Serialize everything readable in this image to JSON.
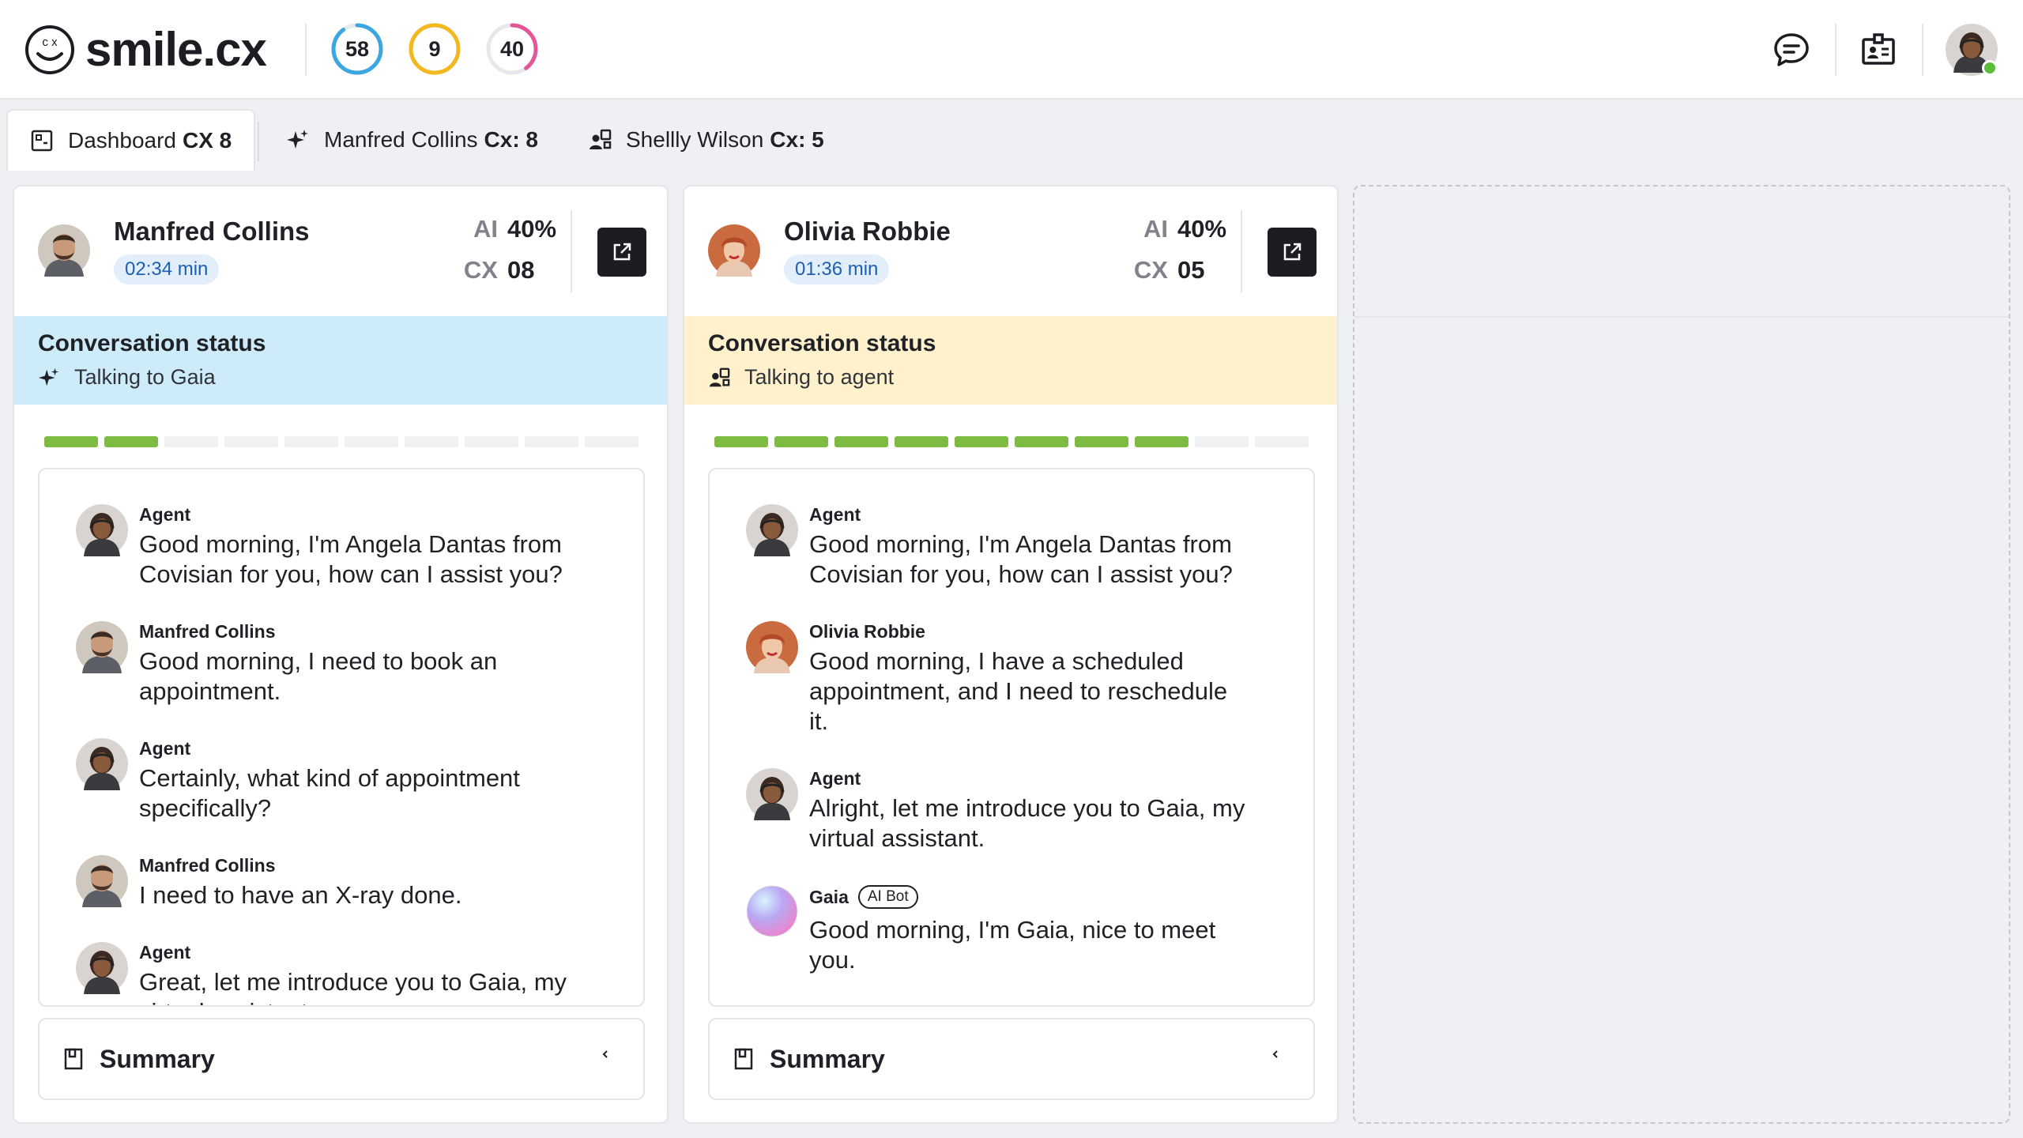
{
  "app": {
    "logo_text": "smile.cx",
    "logo_mark": "c x"
  },
  "header": {
    "rings": [
      {
        "value": "58",
        "color": "#3aa7e0",
        "fraction": 0.9
      },
      {
        "value": "9",
        "color": "#f2b81d",
        "fraction": 1.0
      },
      {
        "value": "40",
        "color": "#e4569a",
        "fraction": 0.4
      }
    ],
    "icons": [
      "chat-bubble-icon",
      "id-badge-icon"
    ],
    "status_color": "#5cbc3c"
  },
  "tabs": [
    {
      "label": "Dashboard",
      "bold": "CX 8",
      "icon": "dashboard-icon",
      "active": true
    },
    {
      "label": "Manfred Collins",
      "bold": "Cx: 8",
      "icon": "sparkle-icon",
      "active": false
    },
    {
      "label": "Shellly Wilson",
      "bold": "Cx: 5",
      "icon": "agent-icon",
      "active": false
    }
  ],
  "panels": [
    {
      "name": "Manfred Collins",
      "time": "02:34 min",
      "ai_label": "AI",
      "ai_value": "40%",
      "cx_label": "CX",
      "cx_value": "08",
      "status_title": "Conversation status",
      "status_text": "Talking to Gaia",
      "progress": 2,
      "progress_total": 10,
      "messages": [
        {
          "author": "Agent",
          "text": "Good morning, I'm Angela Dantas from Covisian for you, how can I assist you?"
        },
        {
          "author": "Manfred Collins",
          "text": "Good morning, I need to book an appointment."
        },
        {
          "author": "Agent",
          "text": "Certainly, what kind of appointment specifically?"
        },
        {
          "author": "Manfred Collins",
          "text": "I need to have an X-ray done."
        },
        {
          "author": "Agent",
          "text": "Great, let me introduce you to Gaia, my virtual assistant."
        }
      ],
      "summary_label": "Summary"
    },
    {
      "name": "Olivia Robbie",
      "time": "01:36 min",
      "ai_label": "AI",
      "ai_value": "40%",
      "cx_label": "CX",
      "cx_value": "05",
      "status_title": "Conversation status",
      "status_text": "Talking to agent",
      "progress": 8,
      "progress_total": 10,
      "messages": [
        {
          "author": "Agent",
          "text": "Good morning, I'm Angela Dantas from Covisian for you, how can I assist you?"
        },
        {
          "author": "Olivia Robbie",
          "text": "Good morning, I have a scheduled appointment, and I need to reschedule it."
        },
        {
          "author": "Agent",
          "text": "Alright, let me introduce you to Gaia, my virtual assistant."
        },
        {
          "author": "Gaia",
          "badge": "AI Bot",
          "text": "Good morning, I'm Gaia, nice to meet you."
        }
      ],
      "summary_label": "Summary"
    }
  ]
}
